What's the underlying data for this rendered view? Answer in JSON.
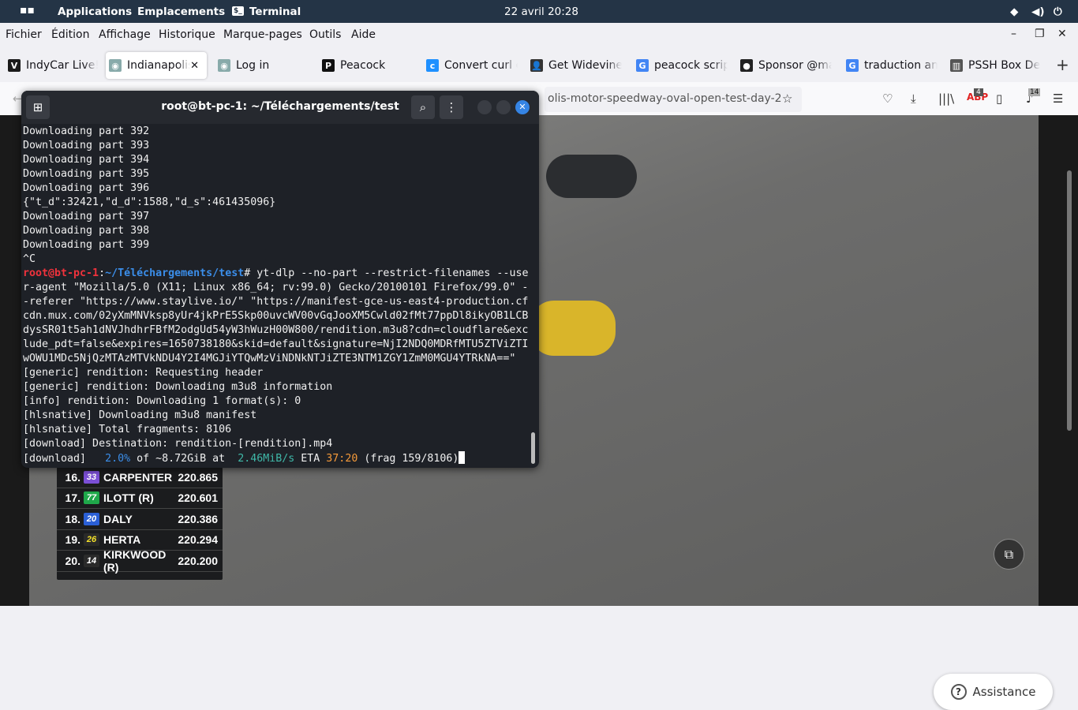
{
  "topbar": {
    "apps": "Applications",
    "places": "Emplacements",
    "terminal": "Terminal",
    "clock": "22 avril  20:28"
  },
  "menu": [
    "Fichier",
    "Édition",
    "Affichage",
    "Historique",
    "Marque-pages",
    "Outils",
    "Aide"
  ],
  "tabs": [
    {
      "label": "IndyCar Live!",
      "icon": "V",
      "color": "#1a1a1a"
    },
    {
      "label": "Indianapolis",
      "icon": "◉",
      "color": "#8aa"
    },
    {
      "label": "Log in",
      "icon": "◉",
      "color": "#8aa"
    },
    {
      "label": "Peacock",
      "icon": "P",
      "color": "#111"
    },
    {
      "label": "Convert curl c",
      "icon": "c",
      "color": "#1e90ff"
    },
    {
      "label": "Get Widevine",
      "icon": "👤",
      "color": "#333"
    },
    {
      "label": "peacock script",
      "icon": "G",
      "color": "#4285f4"
    },
    {
      "label": "Sponsor @ma",
      "icon": "●",
      "color": "#222"
    },
    {
      "label": "traduction anglais",
      "icon": "G",
      "color": "#4285f4"
    },
    {
      "label": "PSSH Box Dec",
      "icon": "▥",
      "color": "#555"
    }
  ],
  "url": "olis-motor-speedway-oval-open-test-day-2",
  "badges": {
    "abp": "4",
    "music": "14"
  },
  "terminal": {
    "title": "root@bt-pc-1: ~/Téléchargements/test",
    "lines_top": [
      "Downloading part 392",
      "Downloading part 393",
      "Downloading part 394",
      "Downloading part 395",
      "Downloading part 396",
      "{\"t_d\":32421,\"d_d\":1588,\"d_s\":461435096}",
      "Downloading part 397",
      "Downloading part 398",
      "Downloading part 399",
      "^C"
    ],
    "prompt_user": "root@bt-pc-1",
    "prompt_sep": ":",
    "prompt_path": "~/Téléchargements/test",
    "prompt_cmd": "# yt-dlp --no-part --restrict-filenames --use",
    "cmd_lines": [
      "r-agent \"Mozilla/5.0 (X11; Linux x86_64; rv:99.0) Gecko/20100101 Firefox/99.0\" -",
      "-referer \"https://www.staylive.io/\" \"https://manifest-gce-us-east4-production.cf",
      "cdn.mux.com/02yXmMNVksp8yUr4jkPrE5Skp00uvcWV00vGqJooXM5Cwld02fMt77ppDl8ikyOB1LCB",
      "dysSR01t5ah1dNVJhdhrFBfM2odgUd54yW3hWuzH00W800/rendition.m3u8?cdn=cloudflare&exc",
      "lude_pdt=false&expires=1650738180&skid=default&signature=NjI2NDQ0MDRfMTU5ZTViZTI",
      "wOWU1MDc5NjQzMTAzMTVkNDU4Y2I4MGJiYTQwMzViNDNkNTJiZTE3NTM1ZGY1ZmM0MGU4YTRkNA==\""
    ],
    "out_lines": [
      "[generic] rendition: Requesting header",
      "[generic] rendition: Downloading m3u8 information",
      "[info] rendition: Downloading 1 format(s): 0",
      "[hlsnative] Downloading m3u8 manifest",
      "[hlsnative] Total fragments: 8106",
      "[download] Destination: rendition-[rendition].mp4"
    ],
    "progress": {
      "prefix": "[download]   ",
      "percent": "2.0%",
      "of": " of ~8.72GiB at  ",
      "speed": "2.46MiB/s",
      "eta_label": " ETA ",
      "eta": "37:20",
      "frag": " (frag 159/8106)"
    }
  },
  "leaderboard": [
    {
      "pos": "16.",
      "num": "33",
      "color": "#7b4fd6",
      "name": "CARPENTER",
      "speed": "220.865"
    },
    {
      "pos": "17.",
      "num": "77",
      "color": "#1fa84a",
      "name": "ILOTT (R)",
      "speed": "220.601"
    },
    {
      "pos": "18.",
      "num": "20",
      "color": "#2a5fd6",
      "name": "DALY",
      "speed": "220.386"
    },
    {
      "pos": "19.",
      "num": "26",
      "color": "#2a2a2a",
      "name": "HERTA",
      "speed": "220.294"
    },
    {
      "pos": "20.",
      "num": "14",
      "color": "#2a2a2a",
      "name": "KIRKWOOD (R)",
      "speed": "220.200"
    }
  ],
  "assist": "Assistance"
}
